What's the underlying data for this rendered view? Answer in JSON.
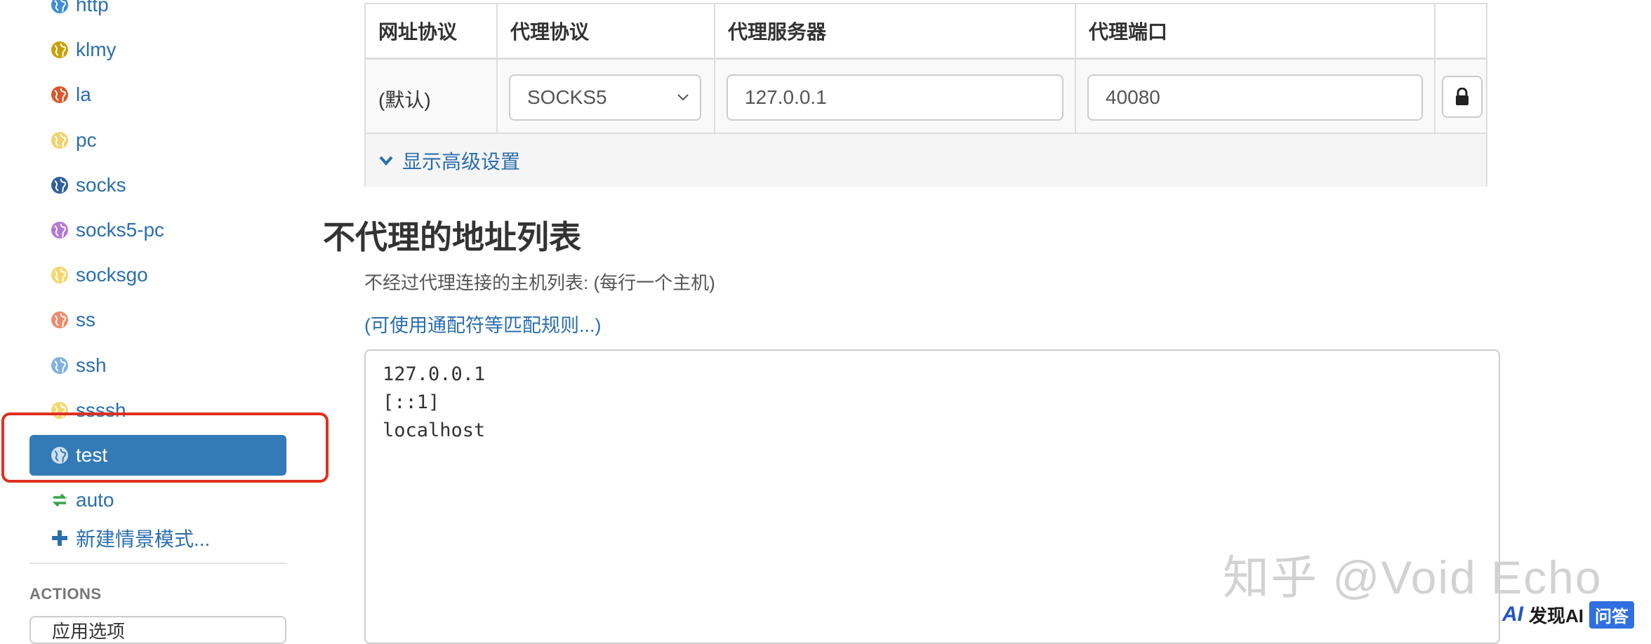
{
  "sidebar": {
    "profiles": [
      {
        "label": "http",
        "color": "#3d8fd6"
      },
      {
        "label": "klmy",
        "color": "#c9a000"
      },
      {
        "label": "la",
        "color": "#d9582b"
      },
      {
        "label": "pc",
        "color": "#f2d36b"
      },
      {
        "label": "socks",
        "color": "#2f5f9e"
      },
      {
        "label": "socks5-pc",
        "color": "#b678d8"
      },
      {
        "label": "socksgo",
        "color": "#f5d76e"
      },
      {
        "label": "ss",
        "color": "#f08a6c"
      },
      {
        "label": "ssh",
        "color": "#7fb2e5"
      },
      {
        "label": "ssssh",
        "color": "#f5d76e"
      },
      {
        "label": "test",
        "color": "#ffffff",
        "active": true
      },
      {
        "label": "auto",
        "color": "#3aa34a"
      }
    ],
    "new_profile_label": "新建情景模式...",
    "actions_title": "ACTIONS",
    "actions_button_label": "应用选项"
  },
  "proxy_table": {
    "headers": [
      "网址协议",
      "代理协议",
      "代理服务器",
      "代理端口"
    ],
    "row": {
      "scheme": "(默认)",
      "protocol": "SOCKS5",
      "server": "127.0.0.1",
      "port": "40080"
    },
    "advanced_link": "显示高级设置"
  },
  "bypass": {
    "title": "不代理的地址列表",
    "description": "不经过代理连接的主机列表: (每行一个主机)",
    "wildcard_link": "(可使用通配符等匹配规则...)",
    "entries": "127.0.0.1\n[::1]\nlocalhost"
  },
  "watermark": {
    "text": "知乎 @Void Echo",
    "logo_mark": "AI",
    "logo_text": "发现AI",
    "logo_qa": "问答"
  },
  "colors": {
    "accent": "#337ab7",
    "link": "#2a6ead",
    "highlight_border": "#e0301e"
  }
}
